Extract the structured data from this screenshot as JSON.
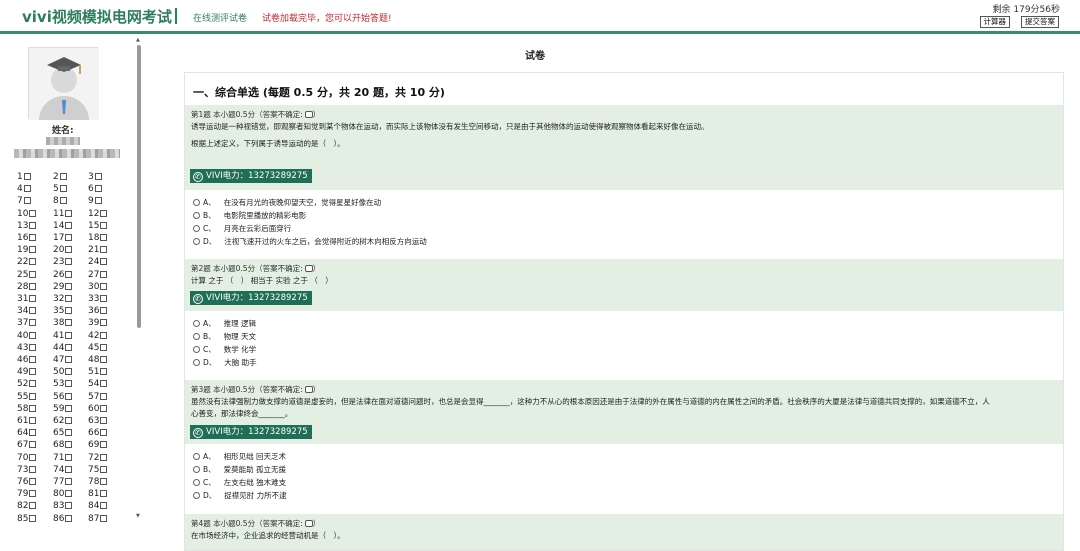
{
  "header": {
    "brand": "vivi视频模拟电网考试",
    "subtitle": "在线测评试卷",
    "notice": "试卷加载完毕，您可以开始答题!",
    "remaining": "剩余 179分56秒",
    "calc_label": "计算器",
    "submit_label": "提交答案"
  },
  "sidebar": {
    "name_label": "姓名:",
    "numbers": [
      "1",
      "2",
      "3",
      "4",
      "5",
      "6",
      "7",
      "8",
      "9",
      "10",
      "11",
      "12",
      "13",
      "14",
      "15",
      "16",
      "17",
      "18",
      "19",
      "20",
      "21",
      "22",
      "23",
      "24",
      "25",
      "26",
      "27",
      "28",
      "29",
      "30",
      "31",
      "32",
      "33",
      "34",
      "35",
      "36",
      "37",
      "38",
      "39",
      "40",
      "41",
      "42",
      "43",
      "44",
      "45",
      "46",
      "47",
      "48",
      "49",
      "50",
      "51",
      "52",
      "53",
      "54",
      "55",
      "56",
      "57",
      "58",
      "59",
      "60",
      "61",
      "62",
      "63",
      "64",
      "65",
      "66",
      "67",
      "68",
      "69",
      "70",
      "71",
      "72",
      "73",
      "74",
      "75",
      "76",
      "77",
      "78",
      "79",
      "80",
      "81",
      "82",
      "83",
      "84",
      "85",
      "86",
      "87"
    ]
  },
  "main": {
    "title": "试卷",
    "section_title": "一、综合单选 (每题 0.5 分，共 20 题，共 10 分)",
    "watermark": "VIVI电力：13273289275",
    "questions": [
      {
        "meta": "第1题  本小题0.5分（答案不确定:",
        "meta_close": "）",
        "text1": "诱导运动是一种视错觉，即观察者知觉到某个物体在运动，而实际上该物体没有发生空间移动，只是由于其他物体的运动使得被观察物体看起来好像在运动。",
        "text2": "根据上述定义，下列属于诱导运动的是（　）。",
        "options": [
          {
            "label": "A、",
            "text": "在没有月光的夜晚仰望天空，觉得星星好像在动"
          },
          {
            "label": "B、",
            "text": "电影院里播放的精彩电影"
          },
          {
            "label": "C、",
            "text": "月亮在云彩后面穿行"
          },
          {
            "label": "D、",
            "text": "注视飞速开过的火车之后，会觉得附近的树木向相反方向运动"
          }
        ]
      },
      {
        "meta": "第2题  本小题0.5分（答案不确定:",
        "meta_close": "）",
        "text1": "计算  之于  （　）  相当于  实验  之于  （　）",
        "options": [
          {
            "label": "A、",
            "text": "推理  逻辑"
          },
          {
            "label": "B、",
            "text": "物理  天文"
          },
          {
            "label": "C、",
            "text": "数学  化学"
          },
          {
            "label": "D、",
            "text": "大脑  助手"
          }
        ]
      },
      {
        "meta": "第3题  本小题0.5分（答案不确定:",
        "meta_close": "）",
        "text1": "虽然没有法律强制力做支撑的道德是虚妄的，但是法律在面对道德问题时，也总是会显得_______，这种力不从心的根本原因还是由于法律的外在属性与道德的内在属性之间的矛盾。社会秩序的大厦是法律与道德共同支撑的，如果道德不立，人",
        "text2": "心善变，那法律终会_______。",
        "options": [
          {
            "label": "A、",
            "text": "相形见绌 回天乏术"
          },
          {
            "label": "B、",
            "text": "爱莫能助 孤立无援"
          },
          {
            "label": "C、",
            "text": "左支右绌 独木难支"
          },
          {
            "label": "D、",
            "text": "捉襟见肘 力所不逮"
          }
        ]
      },
      {
        "meta": "第4题  本小题0.5分（答案不确定:",
        "meta_close": "）",
        "text1": "在市场经济中，企业追求的经营动机是（　）。"
      }
    ]
  }
}
